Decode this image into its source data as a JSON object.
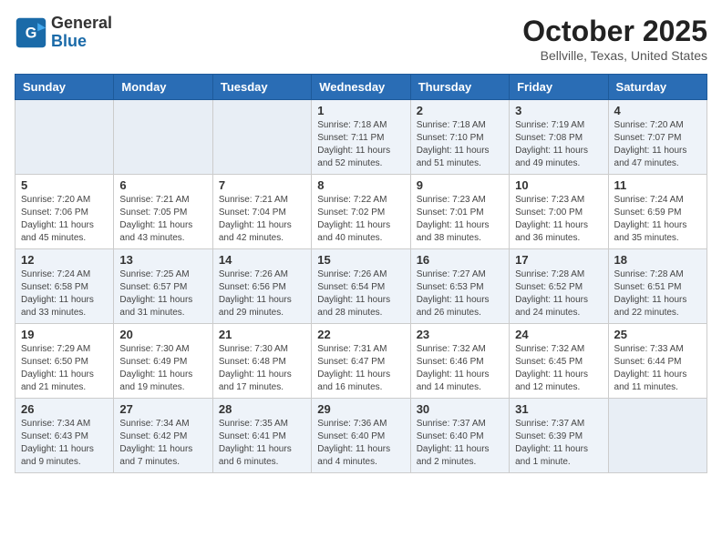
{
  "header": {
    "logo_line1": "General",
    "logo_line2": "Blue",
    "month": "October 2025",
    "location": "Bellville, Texas, United States"
  },
  "weekdays": [
    "Sunday",
    "Monday",
    "Tuesday",
    "Wednesday",
    "Thursday",
    "Friday",
    "Saturday"
  ],
  "weeks": [
    [
      {
        "day": "",
        "info": ""
      },
      {
        "day": "",
        "info": ""
      },
      {
        "day": "",
        "info": ""
      },
      {
        "day": "1",
        "info": "Sunrise: 7:18 AM\nSunset: 7:11 PM\nDaylight: 11 hours\nand 52 minutes."
      },
      {
        "day": "2",
        "info": "Sunrise: 7:18 AM\nSunset: 7:10 PM\nDaylight: 11 hours\nand 51 minutes."
      },
      {
        "day": "3",
        "info": "Sunrise: 7:19 AM\nSunset: 7:08 PM\nDaylight: 11 hours\nand 49 minutes."
      },
      {
        "day": "4",
        "info": "Sunrise: 7:20 AM\nSunset: 7:07 PM\nDaylight: 11 hours\nand 47 minutes."
      }
    ],
    [
      {
        "day": "5",
        "info": "Sunrise: 7:20 AM\nSunset: 7:06 PM\nDaylight: 11 hours\nand 45 minutes."
      },
      {
        "day": "6",
        "info": "Sunrise: 7:21 AM\nSunset: 7:05 PM\nDaylight: 11 hours\nand 43 minutes."
      },
      {
        "day": "7",
        "info": "Sunrise: 7:21 AM\nSunset: 7:04 PM\nDaylight: 11 hours\nand 42 minutes."
      },
      {
        "day": "8",
        "info": "Sunrise: 7:22 AM\nSunset: 7:02 PM\nDaylight: 11 hours\nand 40 minutes."
      },
      {
        "day": "9",
        "info": "Sunrise: 7:23 AM\nSunset: 7:01 PM\nDaylight: 11 hours\nand 38 minutes."
      },
      {
        "day": "10",
        "info": "Sunrise: 7:23 AM\nSunset: 7:00 PM\nDaylight: 11 hours\nand 36 minutes."
      },
      {
        "day": "11",
        "info": "Sunrise: 7:24 AM\nSunset: 6:59 PM\nDaylight: 11 hours\nand 35 minutes."
      }
    ],
    [
      {
        "day": "12",
        "info": "Sunrise: 7:24 AM\nSunset: 6:58 PM\nDaylight: 11 hours\nand 33 minutes."
      },
      {
        "day": "13",
        "info": "Sunrise: 7:25 AM\nSunset: 6:57 PM\nDaylight: 11 hours\nand 31 minutes."
      },
      {
        "day": "14",
        "info": "Sunrise: 7:26 AM\nSunset: 6:56 PM\nDaylight: 11 hours\nand 29 minutes."
      },
      {
        "day": "15",
        "info": "Sunrise: 7:26 AM\nSunset: 6:54 PM\nDaylight: 11 hours\nand 28 minutes."
      },
      {
        "day": "16",
        "info": "Sunrise: 7:27 AM\nSunset: 6:53 PM\nDaylight: 11 hours\nand 26 minutes."
      },
      {
        "day": "17",
        "info": "Sunrise: 7:28 AM\nSunset: 6:52 PM\nDaylight: 11 hours\nand 24 minutes."
      },
      {
        "day": "18",
        "info": "Sunrise: 7:28 AM\nSunset: 6:51 PM\nDaylight: 11 hours\nand 22 minutes."
      }
    ],
    [
      {
        "day": "19",
        "info": "Sunrise: 7:29 AM\nSunset: 6:50 PM\nDaylight: 11 hours\nand 21 minutes."
      },
      {
        "day": "20",
        "info": "Sunrise: 7:30 AM\nSunset: 6:49 PM\nDaylight: 11 hours\nand 19 minutes."
      },
      {
        "day": "21",
        "info": "Sunrise: 7:30 AM\nSunset: 6:48 PM\nDaylight: 11 hours\nand 17 minutes."
      },
      {
        "day": "22",
        "info": "Sunrise: 7:31 AM\nSunset: 6:47 PM\nDaylight: 11 hours\nand 16 minutes."
      },
      {
        "day": "23",
        "info": "Sunrise: 7:32 AM\nSunset: 6:46 PM\nDaylight: 11 hours\nand 14 minutes."
      },
      {
        "day": "24",
        "info": "Sunrise: 7:32 AM\nSunset: 6:45 PM\nDaylight: 11 hours\nand 12 minutes."
      },
      {
        "day": "25",
        "info": "Sunrise: 7:33 AM\nSunset: 6:44 PM\nDaylight: 11 hours\nand 11 minutes."
      }
    ],
    [
      {
        "day": "26",
        "info": "Sunrise: 7:34 AM\nSunset: 6:43 PM\nDaylight: 11 hours\nand 9 minutes."
      },
      {
        "day": "27",
        "info": "Sunrise: 7:34 AM\nSunset: 6:42 PM\nDaylight: 11 hours\nand 7 minutes."
      },
      {
        "day": "28",
        "info": "Sunrise: 7:35 AM\nSunset: 6:41 PM\nDaylight: 11 hours\nand 6 minutes."
      },
      {
        "day": "29",
        "info": "Sunrise: 7:36 AM\nSunset: 6:40 PM\nDaylight: 11 hours\nand 4 minutes."
      },
      {
        "day": "30",
        "info": "Sunrise: 7:37 AM\nSunset: 6:40 PM\nDaylight: 11 hours\nand 2 minutes."
      },
      {
        "day": "31",
        "info": "Sunrise: 7:37 AM\nSunset: 6:39 PM\nDaylight: 11 hours\nand 1 minute."
      },
      {
        "day": "",
        "info": ""
      }
    ]
  ]
}
